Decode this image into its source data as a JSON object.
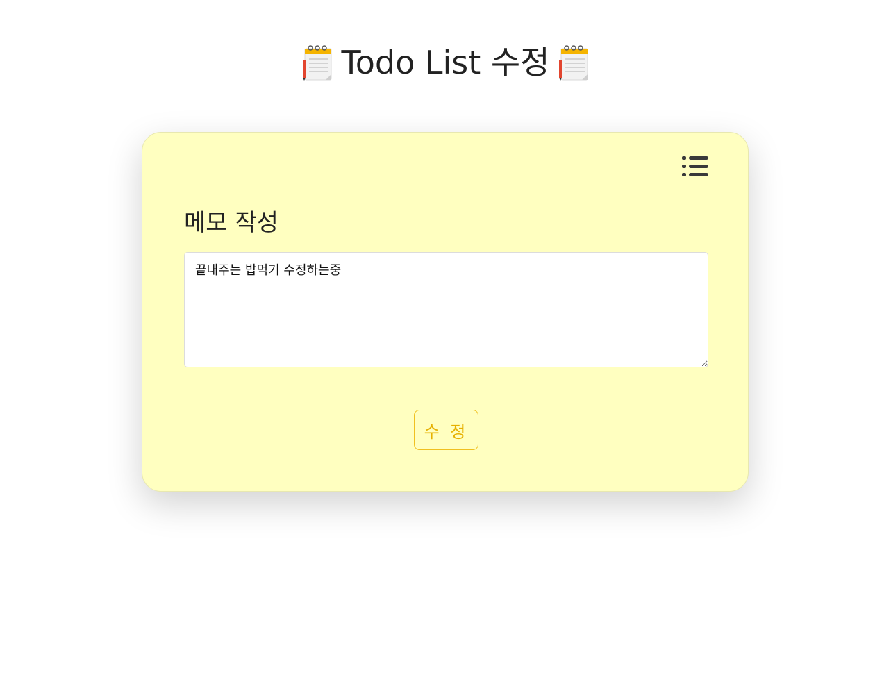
{
  "header": {
    "title": "Todo List 수정",
    "left_icon": "notepad-icon",
    "right_icon": "notepad-icon"
  },
  "card": {
    "list_icon": "list-icon",
    "section_title": "메모 작성",
    "memo_value": "끝내주는 밥먹기 수정하는중",
    "submit_label": "수 정",
    "colors": {
      "card_bg": "#ffffc0",
      "accent": "#e6b000",
      "accent_border": "#f0c020",
      "icon": "#3a3a3a"
    }
  }
}
